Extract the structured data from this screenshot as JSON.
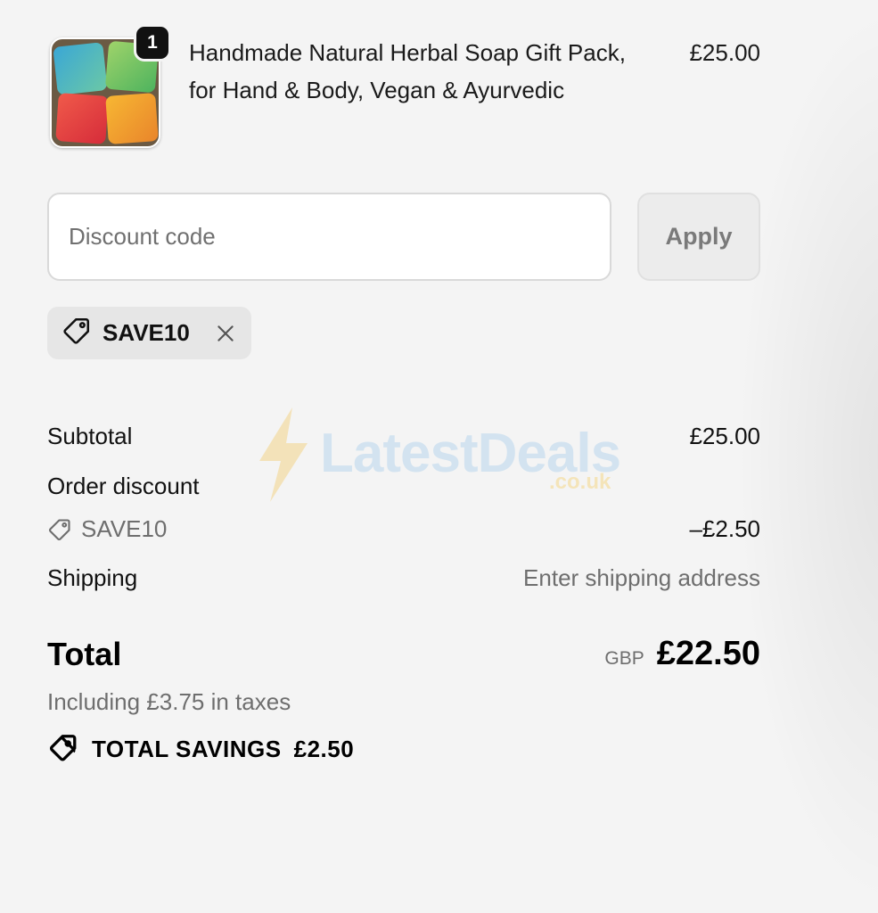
{
  "product": {
    "quantity": "1",
    "title": "Handmade Natural Herbal Soap Gift Pack, for Hand & Body, Vegan & Ayurvedic",
    "price": "£25.00"
  },
  "discount": {
    "placeholder": "Discount code",
    "apply_label": "Apply",
    "applied_code": "SAVE10"
  },
  "summary": {
    "subtotal_label": "Subtotal",
    "subtotal_value": "£25.00",
    "order_discount_label": "Order discount",
    "discount_code": "SAVE10",
    "discount_value": "–£2.50",
    "shipping_label": "Shipping",
    "shipping_value": "Enter shipping address",
    "total_label": "Total",
    "currency": "GBP",
    "total_value": "£22.50",
    "taxes_note": "Including £3.75 in taxes",
    "savings_label": "TOTAL SAVINGS",
    "savings_value": "£2.50"
  },
  "watermark": {
    "brand": "LatestDeals",
    "domain": ".co.uk"
  },
  "colors": {
    "background": "#f4f4f4",
    "muted_text": "#6e6e6e",
    "chip_bg": "#e6e6e6"
  }
}
